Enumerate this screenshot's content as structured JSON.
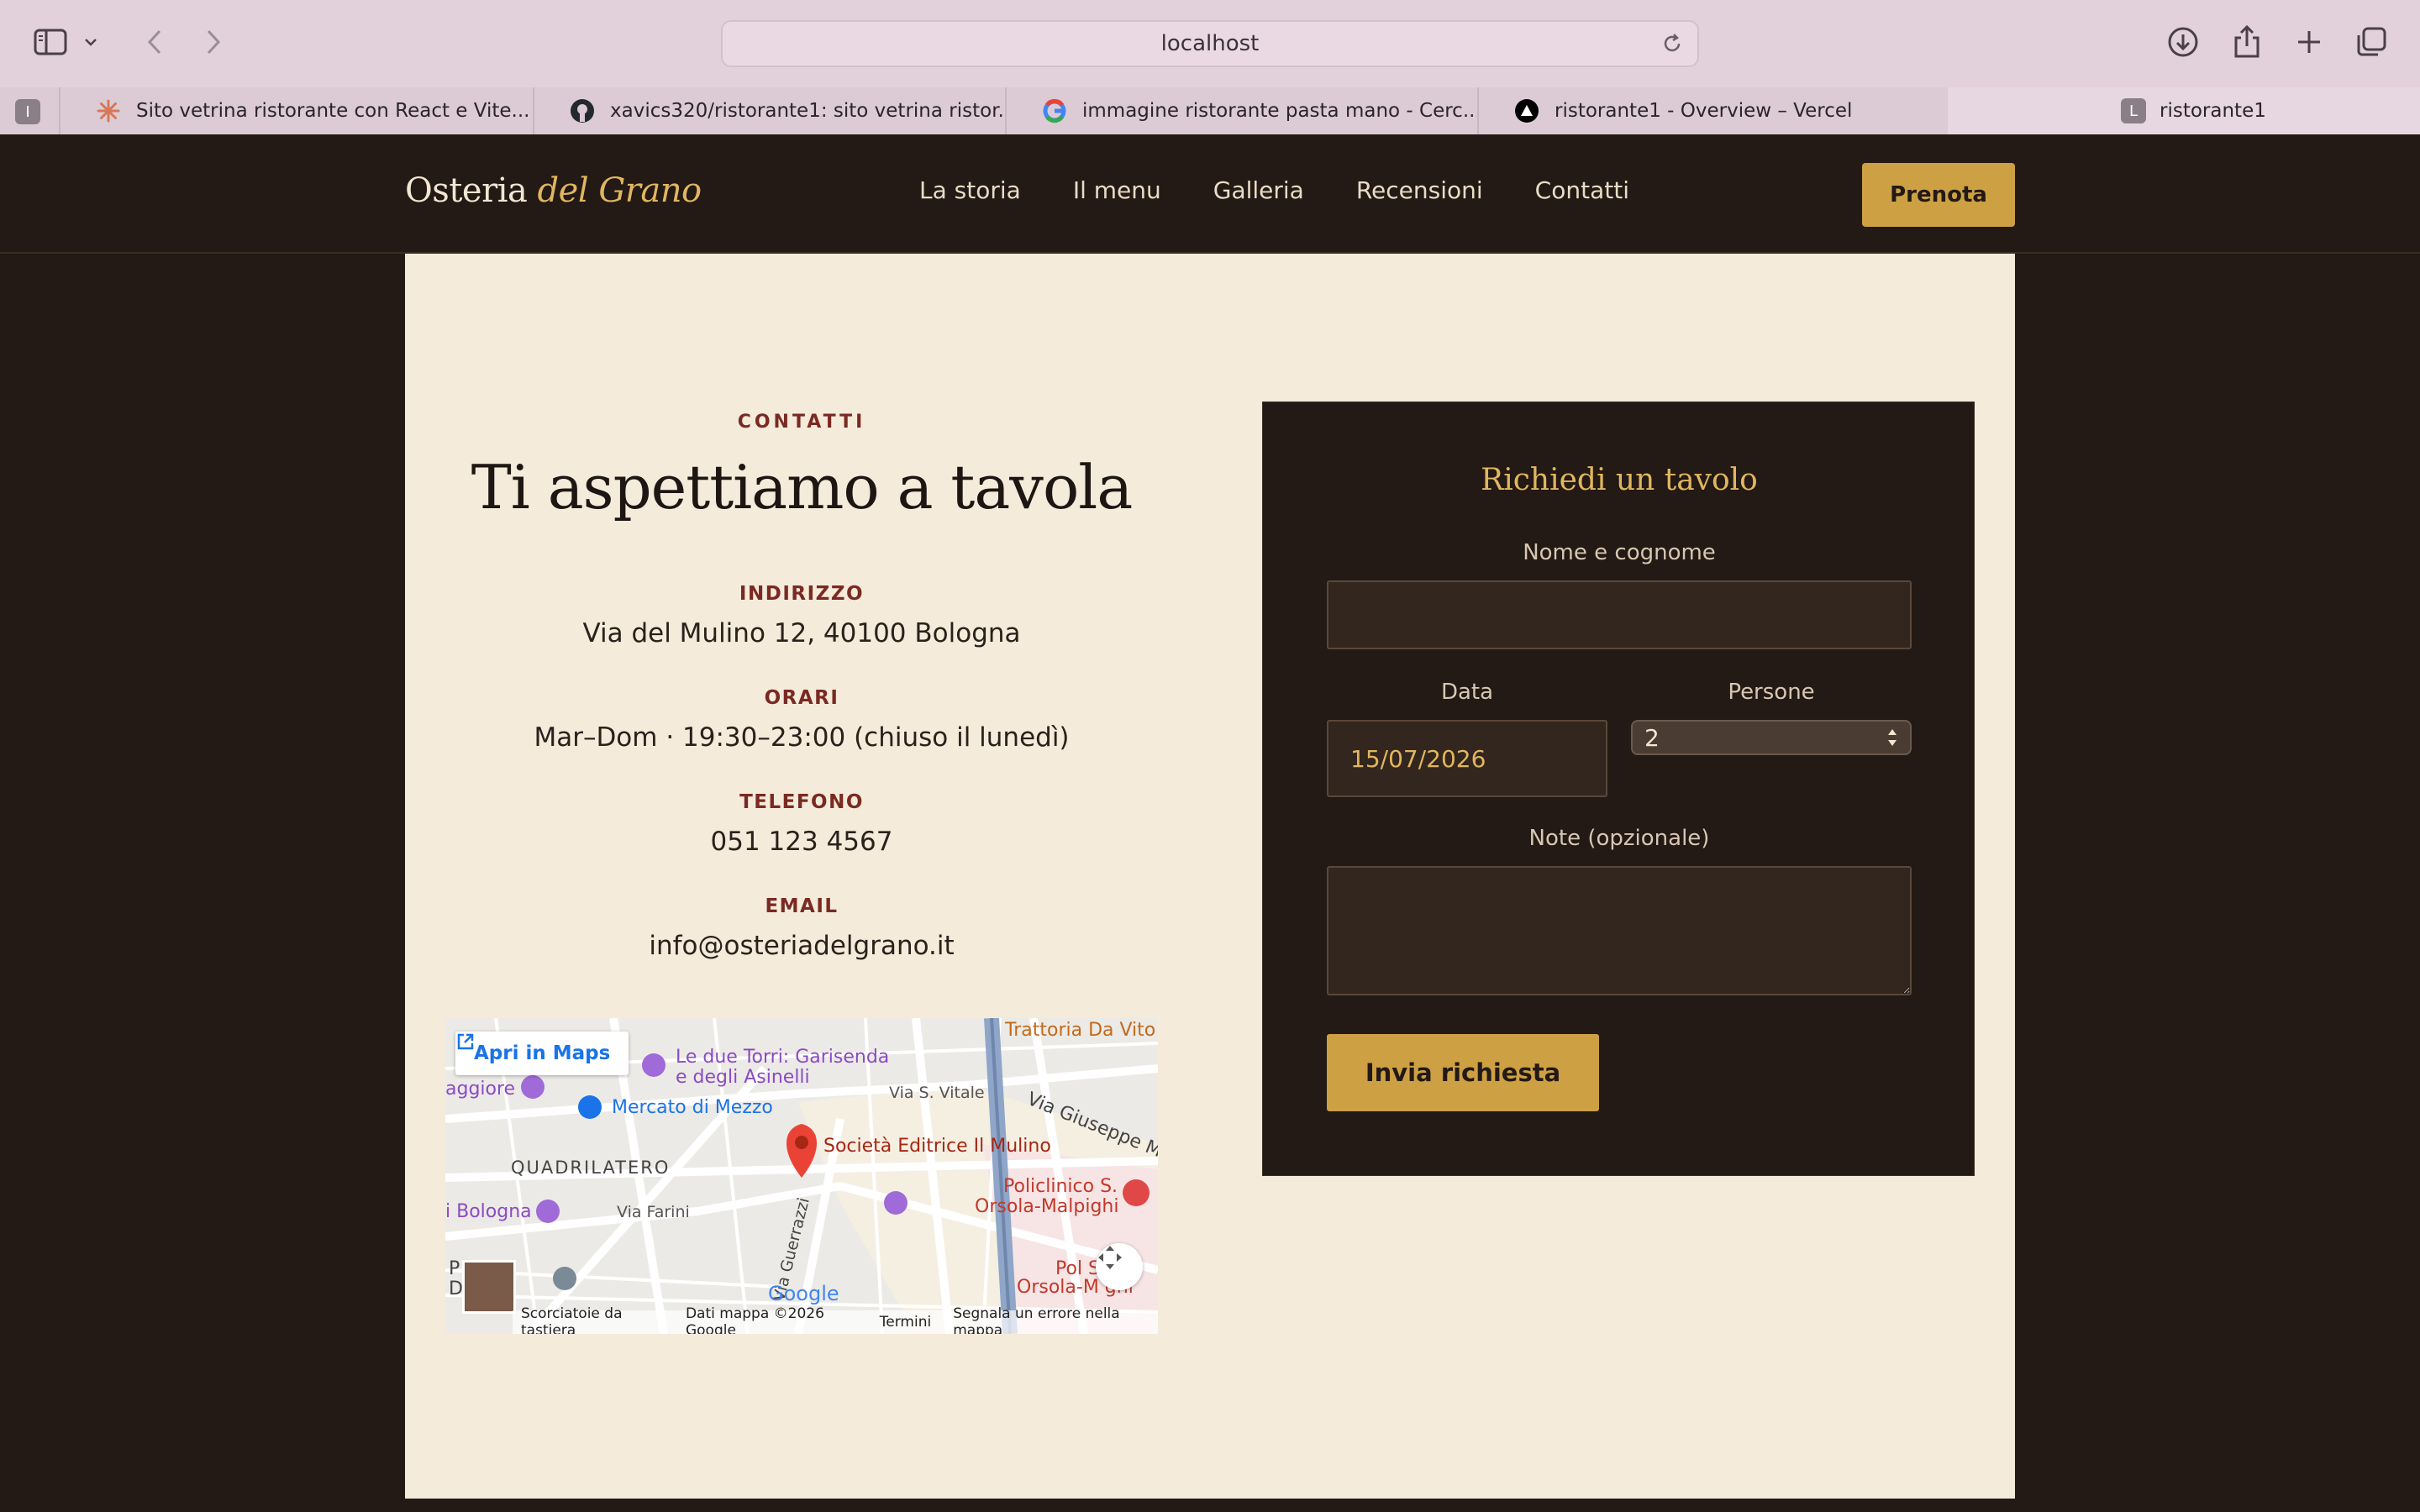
{
  "browser": {
    "address": "localhost",
    "tabs": [
      {
        "title": "Sito vetrina ristorante con React e Vite..."
      },
      {
        "title": "xavics320/ristorante1: sito vetrina ristor..."
      },
      {
        "title": "immagine ristorante pasta mano - Cerc..."
      },
      {
        "title": "ristorante1 - Overview – Vercel"
      }
    ],
    "pinned_tab_letter": "I",
    "active_tab": {
      "title": "ristorante1",
      "fav_letter": "L"
    }
  },
  "site": {
    "logo_main": "Osteria",
    "logo_accent": "del Grano",
    "nav": [
      "La storia",
      "Il menu",
      "Galleria",
      "Recensioni",
      "Contatti"
    ],
    "cta": "Prenota"
  },
  "contact": {
    "eyebrow": "CONTATTI",
    "title": "Ti aspettiamo a tavola",
    "address_label": "INDIRIZZO",
    "address": "Via del Mulino 12, 40100 Bologna",
    "hours_label": "ORARI",
    "hours": "Mar–Dom · 19:30–23:00 (chiuso il lunedì)",
    "phone_label": "TELEFONO",
    "phone": "051 123 4567",
    "email_label": "EMAIL",
    "email": "info@osteriadelgrano.it"
  },
  "map": {
    "open_button": "Apri in Maps",
    "labels": {
      "trattoria": "Trattoria Da Vito",
      "torri_1": "Le due Torri: Garisenda",
      "torri_2": "e degli Asinelli",
      "maggiore": "aggiore",
      "mercato": "Mercato di Mezzo",
      "vitale": "Via S. Vitale",
      "giuseppe": "Via Giuseppe Mass",
      "pin": "Società Editrice Il Mulino",
      "quadrilatero": "QUADRILATERO",
      "policlinico_1": "Policlinico S.",
      "policlinico_2": "Orsola-Malpighi",
      "bologna": "i Bologna",
      "farini": "Via Farini",
      "guerrazzi": "Via Guerrazzi",
      "pale": "P  ale",
      "co": "D  co",
      "pol2": "Pol   S",
      "orsola2": "Orsola-M  ghi"
    },
    "google": "Google",
    "footer": [
      "Scorciatoie da tastiera",
      "Dati mappa ©2026 Google",
      "Termini",
      "Segnala un errore nella mappa"
    ]
  },
  "form": {
    "title": "Richiedi un tavolo",
    "name_label": "Nome e cognome",
    "name_value": "",
    "date_label": "Data",
    "date_value": "15/07/2026",
    "people_label": "Persone",
    "people_value": "2",
    "notes_label": "Note (opzionale)",
    "notes_value": "",
    "submit": "Invia richiesta"
  },
  "colors": {
    "dark": "#231915",
    "cream": "#f4ebdb",
    "gold": "#cda043",
    "burgundy": "#7a2a22"
  }
}
